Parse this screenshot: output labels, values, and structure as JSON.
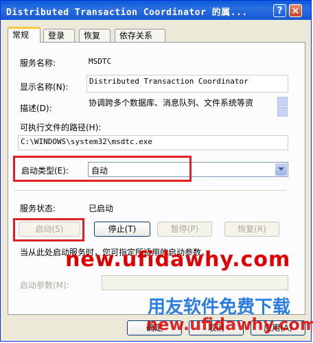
{
  "window": {
    "title": "Distributed Transaction Coordinator 的属...",
    "help": "?",
    "close": "×"
  },
  "tabs": [
    "常规",
    "登录",
    "恢复",
    "依存关系"
  ],
  "general": {
    "service_name_label": "服务名称:",
    "service_name": "MSDTC",
    "display_name_label": "显示名称(N):",
    "display_name": "Distributed Transaction Coordinator",
    "description_label": "描述(D):",
    "description": "协调跨多个数据库、消息队列、文件系统等资",
    "exe_path_label": "可执行文件的路径(H):",
    "exe_path": "C:\\WINDOWS\\system32\\msdtc.exe",
    "startup_type_label": "启动类型(E):",
    "startup_type": "自动",
    "status_label": "服务状态:",
    "status": "已启动",
    "start_button": "启动(S)",
    "stop_button": "停止(T)",
    "pause_button": "暂停(P)",
    "resume_button": "恢复(R)",
    "hint": "当从此处启动服务时，您可指定所适用的启动参数。",
    "start_params_label": "启动参数(M):",
    "start_params": ""
  },
  "buttons": {
    "ok": "确定",
    "cancel": "取消",
    "apply": "应用(A)"
  },
  "watermark": {
    "url": "new.ufidawhy.com",
    "slogan": "用友软件免费下载",
    "url2": "new.ufidawhy.com"
  },
  "colors": {
    "highlight": "#e02020",
    "watermark_red": "#e00000",
    "watermark_blue": "#2a7de1"
  }
}
